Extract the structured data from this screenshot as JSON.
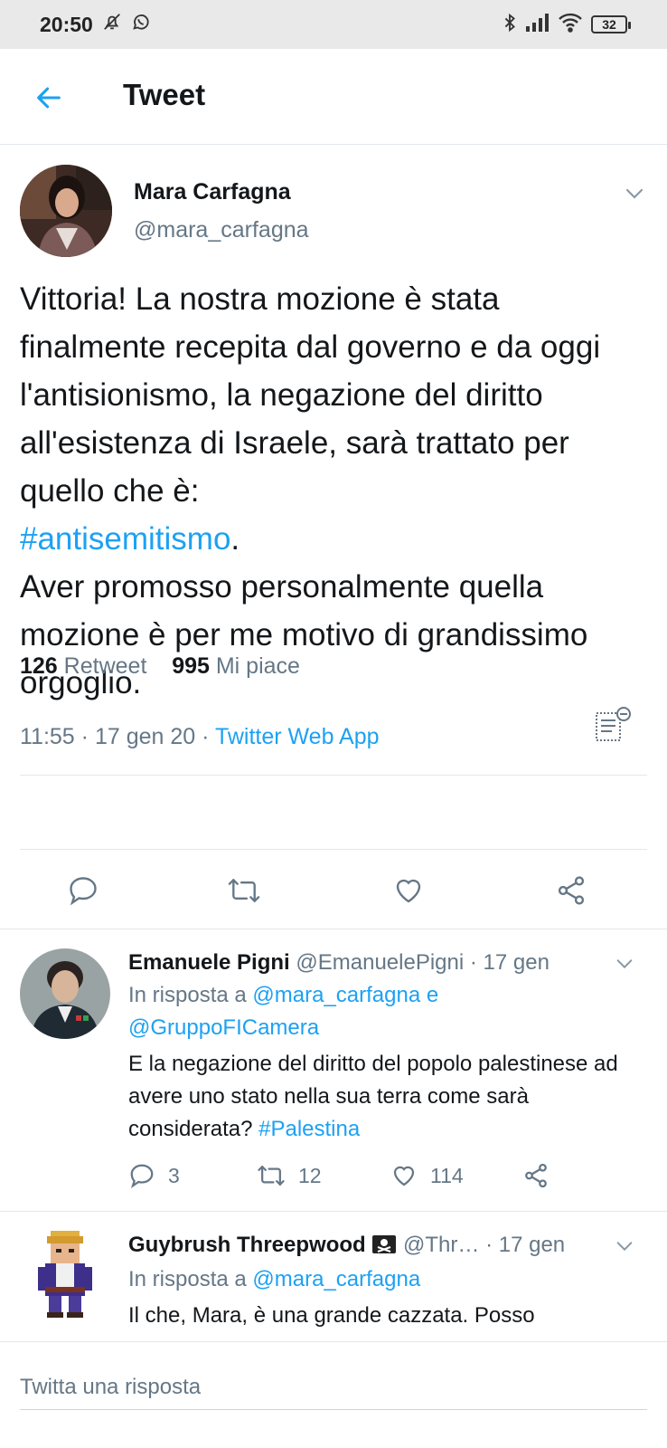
{
  "status_bar": {
    "time": "20:50",
    "battery": "32"
  },
  "header": {
    "title": "Tweet"
  },
  "tweet": {
    "author_name": "Mara Carfagna",
    "author_handle": "@mara_carfagna",
    "text_line1": "Vittoria! La nostra mozione è stata finalmente recepita dal governo e da oggi l'antisionismo, la negazione del diritto all'esistenza di Israele, sarà trattato per quello che è:",
    "hashtag": "#antisemitismo",
    "text_after_hashtag": ".",
    "text_para2": "Aver promosso personalmente quella mozione è per me motivo di grandissimo orgoglio.",
    "time": "11:55",
    "date": "17 gen 20",
    "source": "Twitter Web App",
    "retweet_count": "126",
    "retweet_label": "Retweet",
    "like_count": "995",
    "like_label": "Mi piace",
    "separator": "·"
  },
  "replies": [
    {
      "name": "Emanuele Pigni",
      "handle": "@EmanuelePigni",
      "date": "· 17 gen",
      "in_reply_prefix": "In risposta a",
      "mention1": "@mara_carfagna",
      "conj": "e",
      "mention2": "@GruppoFICamera",
      "text": "E la negazione del diritto del popolo palestinese ad avere uno stato nella sua terra come sarà considerata?",
      "hashtag": "#Palestina",
      "reply_count": "3",
      "retweet_count": "12",
      "like_count": "114"
    },
    {
      "name": "Guybrush Threepwood",
      "handle": "@Thr…",
      "date": "· 17 gen",
      "in_reply_prefix": "In risposta a",
      "mention1": "@mara_carfagna",
      "text": "Il che, Mara, è una grande cazzata. Posso"
    }
  ],
  "compose": {
    "placeholder": "Twitta una risposta"
  },
  "colors": {
    "accent": "#1da1f2",
    "muted": "#657786",
    "text": "#14171a",
    "divider": "#e1e8ed"
  }
}
